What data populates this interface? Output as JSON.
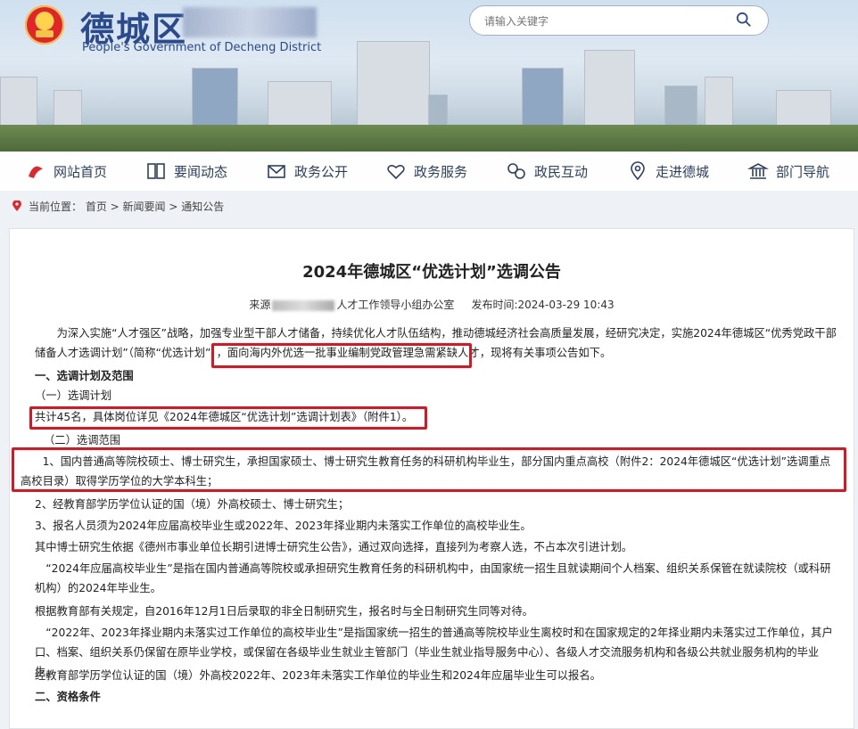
{
  "header": {
    "title": "德城区",
    "subtitle": "People's Government of Decheng District",
    "search_placeholder": "请输入关键字"
  },
  "nav": [
    {
      "label": "网站首页",
      "icon": "home-icon"
    },
    {
      "label": "要闻动态",
      "icon": "book-icon"
    },
    {
      "label": "政务公开",
      "icon": "mail-icon"
    },
    {
      "label": "政务服务",
      "icon": "heart-icon"
    },
    {
      "label": "政民互动",
      "icon": "chat-icon"
    },
    {
      "label": "走进德城",
      "icon": "location-icon"
    },
    {
      "label": "部门导航",
      "icon": "building-icon"
    }
  ],
  "breadcrumb": {
    "prefix": "当前位置：",
    "items": [
      "首页",
      "新闻要闻",
      "通知公告"
    ],
    "sep": " > "
  },
  "article": {
    "title": "2024年德城区“优选计划”选调公告",
    "source_prefix": "来源",
    "source_suffix": "人才工作领导小组办公室",
    "date_label": "发布时间:2024-03-29 10:43",
    "paragraphs": [
      "为深入实施“人才强区”战略，加强专业型干部人才储备，持续优化人才队伍结构，推动德城经济社会高质量发展，经研究决定，实施2024年德城区“优秀党政干部储备人才选调计划”（简称“优选计划”），面向海内外优选一批事业编制党政管理急需紧缺人才，现将有关事项公告如下。",
      "一、选调计划及范围",
      "（一）选调计划",
      "共计45名，具体岗位详见《2024年德城区“优选计划”选调计划表》（附件1）。",
      "（二）选调范围",
      "1、国内普通高等院校硕士、博士研究生，承担国家硕士、博士研究生教育任务的科研机构毕业生，部分国内重点高校（附件2：2024年德城区“优选计划”选调重点高校目录）取得学历学位的大学本科生；",
      "2、经教育部学历学位认证的国（境）外高校硕士、博士研究生；",
      "3、报名人员须为2024年应届高校毕业生或2022年、2023年择业期内未落实工作单位的高校毕业生。",
      "其中博士研究生依据《德州市事业单位长期引进博士研究生公告》，通过双向选择，直接列为考察人选，不占本次引进计划。",
      "“2024年应届高校毕业生”是指在国内普通高等院校或承担研究生教育任务的科研机构中，由国家统一招生且就读期间个人档案、组织关系保管在就读院校（或科研机构）的2024年毕业生。",
      "根据教育部有关规定，自2016年12月1日后录取的非全日制研究生，报名时与全日制研究生同等对待。",
      "“2022年、2023年择业期内未落实过工作单位的高校毕业生”是指国家统一招生的普通高等院校毕业生离校时和在国家规定的2年择业期内未落实过工作单位，其户口、档案、组织关系仍保留在原毕业学校，或保留在各级毕业生就业主管部门（毕业生就业指导服务中心）、各级人才交流服务机构和各级公共就业服务机构的毕业生。",
      "经教育部学历学位认证的国（境）外高校2022年、2023年未落实工作单位的毕业生和2024年应届毕业生可以报名。",
      "二、资格条件"
    ]
  }
}
